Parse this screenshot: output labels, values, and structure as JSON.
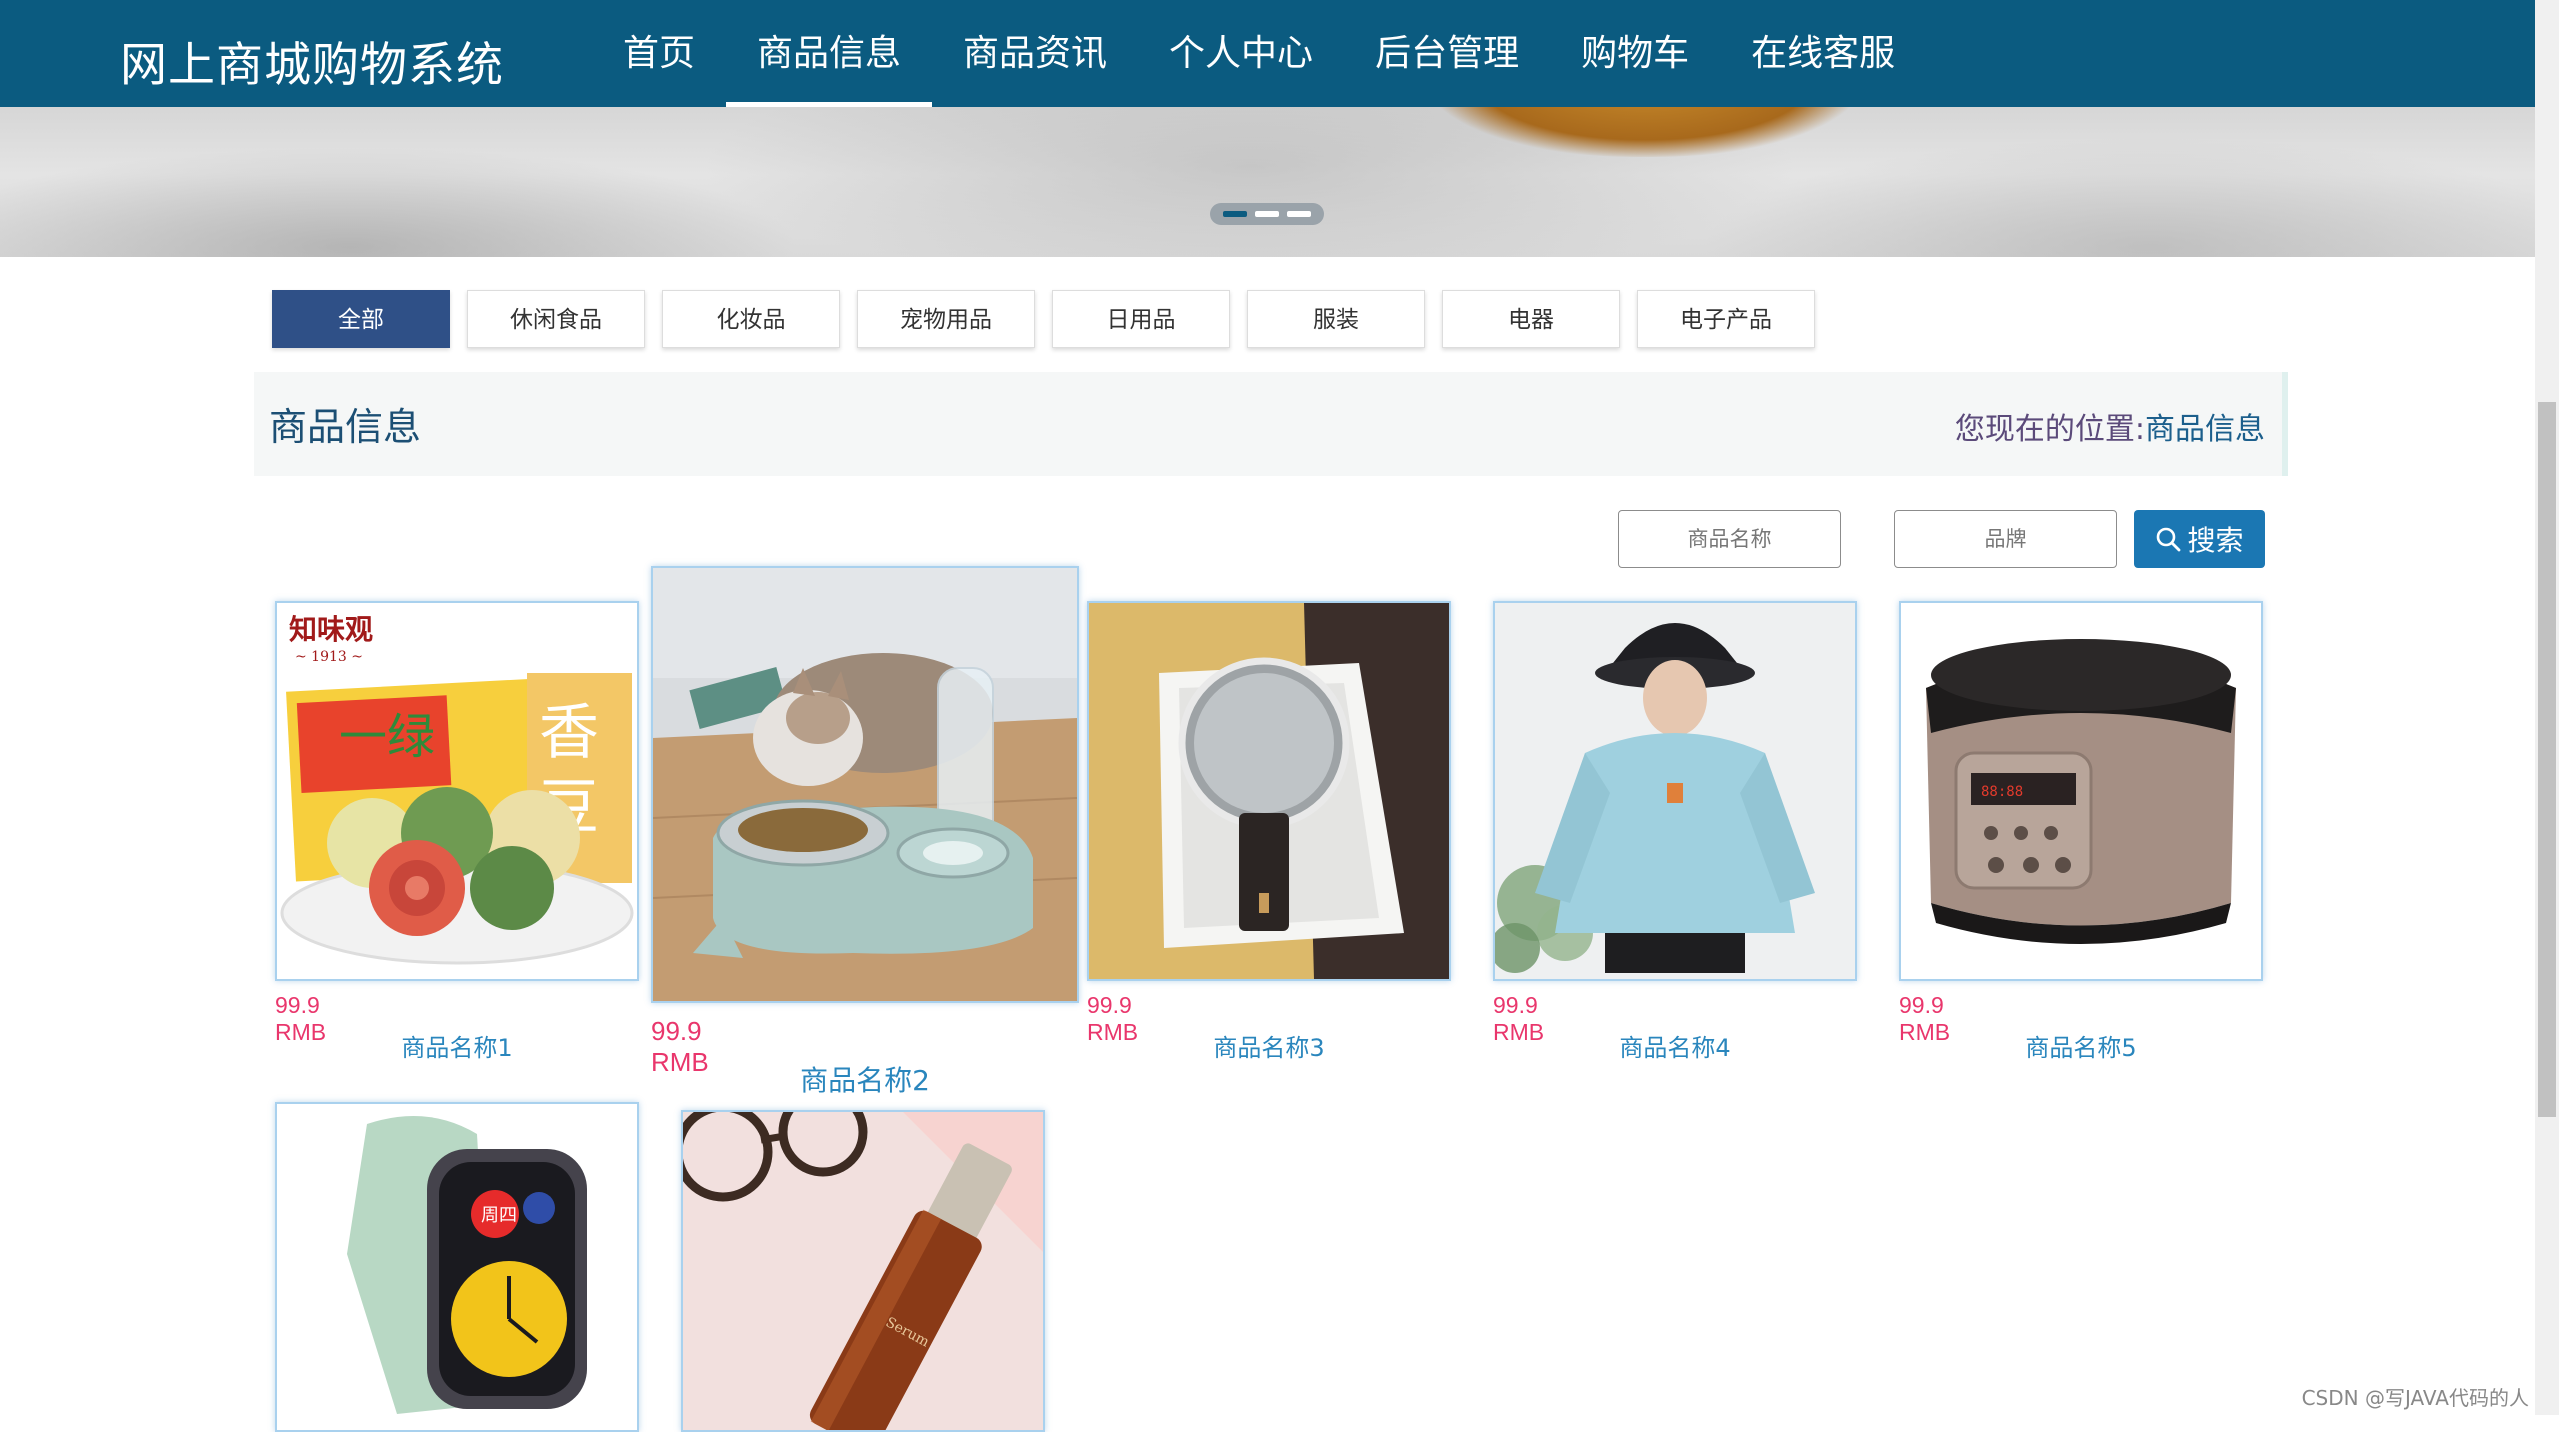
{
  "header": {
    "brand": "网上商城购物系统",
    "nav": [
      {
        "label": "首页"
      },
      {
        "label": "商品信息",
        "active": true
      },
      {
        "label": "商品资讯"
      },
      {
        "label": "个人中心"
      },
      {
        "label": "后台管理"
      },
      {
        "label": "购物车"
      },
      {
        "label": "在线客服"
      }
    ]
  },
  "banner": {
    "slide_count": 3,
    "active_slide": 1
  },
  "categories": [
    "全部",
    "休闲食品",
    "化妆品",
    "宠物用品",
    "日用品",
    "服装",
    "电器",
    "电子产品"
  ],
  "section": {
    "title": "商品信息",
    "breadcrumb_label": "您现在的位置:",
    "breadcrumb_value": "商品信息"
  },
  "search": {
    "name_placeholder": "商品名称",
    "brand_placeholder": "品牌",
    "button_label": "搜索"
  },
  "products": [
    {
      "price": "99.9 RMB",
      "name": "商品名称1",
      "image": "food-mooncake-box"
    },
    {
      "price": "99.9 RMB",
      "name": "商品名称2",
      "image": "cat-feeder-bowl"
    },
    {
      "price": "99.9 RMB",
      "name": "商品名称3",
      "image": "makeup-mirror"
    },
    {
      "price": "99.9 RMB",
      "name": "商品名称4",
      "image": "blue-hoodie-model"
    },
    {
      "price": "99.9 RMB",
      "name": "商品名称5",
      "image": "rice-cooker"
    },
    {
      "image": "smart-watch"
    },
    {
      "image": "serum-bottle"
    }
  ],
  "watermark": "CSDN @写JAVA代码的人",
  "colors": {
    "nav_bg": "#0b5b80",
    "active_tab": "#2f5087",
    "price": "#e9366c",
    "link": "#2a86bd",
    "search_btn": "#1b77b3"
  }
}
